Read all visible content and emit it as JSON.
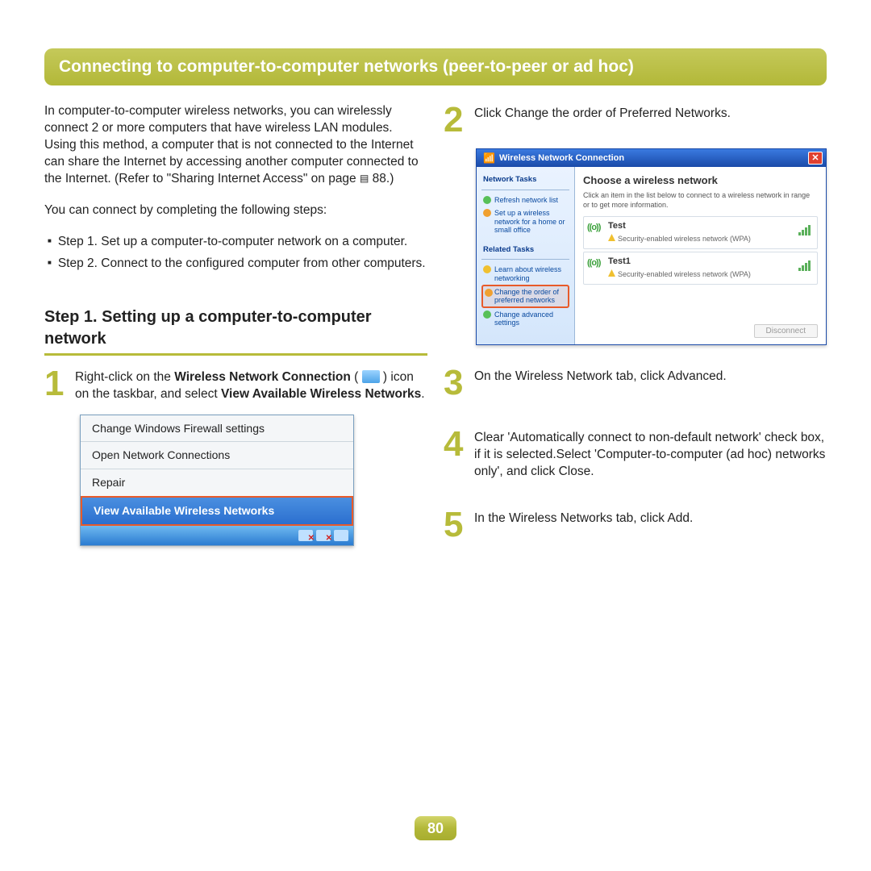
{
  "section_title": "Connecting to computer-to-computer networks (peer-to-peer or ad hoc)",
  "left": {
    "intro1": "In computer-to-computer wireless networks, you can wirelessly connect 2 or more computers that have wireless LAN modules. Using this method, a computer that is not connected to the Internet can share the Internet by accessing another computer connected to the Internet. (Refer to \"Sharing Internet Access\" on page ",
    "intro1_page": "88.)",
    "intro2": "You can connect by completing the following steps:",
    "bullets": [
      "Step 1. Set up a computer-to-computer network on a computer.",
      "Step 2. Connect to the configured computer from other computers."
    ],
    "step_heading": "Step 1. Setting up a computer-to-computer network",
    "n1_a": "Right-click on the ",
    "n1_b_bold": "Wireless Network Connection",
    "n1_c": " ( ",
    "n1_d": " ) icon on the taskbar, and select ",
    "n1_e_bold": "View Available Wireless Networks",
    "n1_f": ".",
    "ctx_items": [
      "Change Windows Firewall settings",
      "Open Network Connections",
      "Repair"
    ],
    "ctx_highlight": "View Available Wireless Networks"
  },
  "right": {
    "n2": "Click Change the order of Preferred Networks.",
    "xp": {
      "title": "Wireless Network Connection",
      "side_head1": "Network Tasks",
      "link_refresh": "Refresh network list",
      "link_setup": "Set up a wireless network for a home or small office",
      "side_head2": "Related Tasks",
      "link_learn": "Learn about wireless networking",
      "link_change": "Change the order of preferred networks",
      "link_adv": "Change advanced settings",
      "main_title": "Choose a wireless network",
      "main_sub": "Click an item in the list below to connect to a wireless network in range or to get more information.",
      "net1_name": "Test",
      "net1_sec": "Security-enabled wireless network (WPA)",
      "net2_name": "Test1",
      "net2_sec": "Security-enabled wireless network (WPA)",
      "btn_disconnect": "Disconnect"
    },
    "n3": "On the Wireless Network tab, click Advanced.",
    "n4": "Clear 'Automatically connect to non-default network' check box, if it is selected.Select 'Computer-to-computer (ad hoc) networks only', and click Close.",
    "n5": "In the Wireless Networks tab, click Add."
  },
  "page_number": "80"
}
